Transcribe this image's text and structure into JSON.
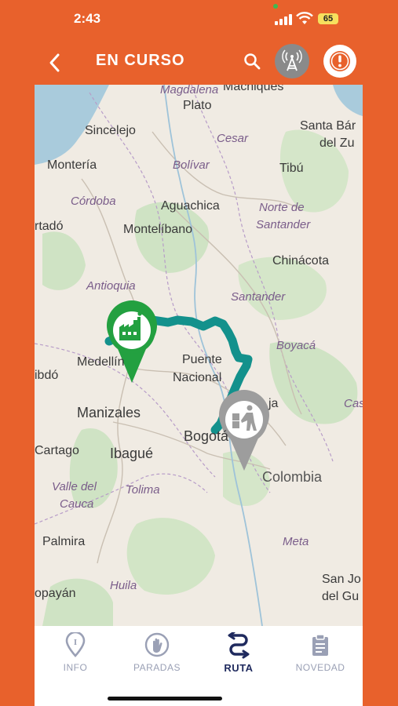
{
  "status_bar": {
    "time": "2:43",
    "battery": "65",
    "battery_color": "#f6e05e"
  },
  "header": {
    "title": "EN CURSO",
    "back_icon": "chevron-left-icon",
    "search_icon": "search-icon",
    "antenna_icon": "antenna-icon",
    "alert_icon": "alert-icon",
    "bg_color": "#e8612c"
  },
  "map": {
    "cities": [
      "Plato",
      "Machiques",
      "Sincelejo",
      "Santa Bár",
      "del Zu",
      "Montería",
      "Tibú",
      "Aguachica",
      "Montelíbano",
      "Chinácota",
      "rtadó",
      "Medellín",
      "ibdó",
      "Puente",
      "Nacional",
      "Manizales",
      "ja",
      "Bogotá",
      "Cartago",
      "Ibagué",
      "Colombia",
      "Palmira",
      "San Jo",
      "del Gu",
      "opayán"
    ],
    "regions": [
      "Magdalena",
      "Cesar",
      "Bolívar",
      "Córdoba",
      "Norte de",
      "Santander",
      "Antioquia",
      "Santander",
      "Boyacá",
      "Cas",
      "Valle del",
      "Cauca",
      "Tolima",
      "Meta",
      "Huila"
    ],
    "origin_marker": "factory-icon",
    "destination_marker": "delivery-person-icon",
    "route_color": "#13918c"
  },
  "nav": {
    "items": [
      {
        "label": "INFO",
        "icon": "info-pin-icon"
      },
      {
        "label": "PARADAS",
        "icon": "hand-stop-icon"
      },
      {
        "label": "RUTA",
        "icon": "route-icon"
      },
      {
        "label": "NOVEDAD",
        "icon": "clipboard-icon"
      }
    ],
    "active": "RUTA"
  }
}
